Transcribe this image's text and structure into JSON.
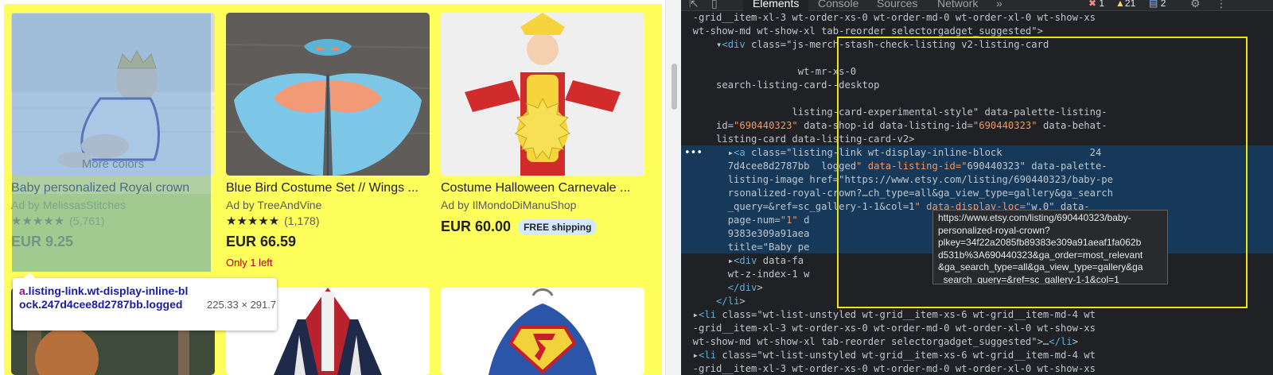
{
  "products": [
    {
      "more_colors": "More colors",
      "title": "Baby personalized Royal crown",
      "ad": "Ad by MelissasStitches",
      "stars": "★★★★★",
      "reviews": "(5,761)",
      "price": "EUR 9.25"
    },
    {
      "title": "Blue Bird Costume Set // Wings ...",
      "ad": "Ad by TreeAndVine",
      "stars": "★★★★★",
      "reviews": "(1,178)",
      "price": "EUR 66.59",
      "stock": "Only 1 left"
    },
    {
      "title": "Costume Halloween Carnevale ...",
      "ad": "Ad by IlMondoDiManuShop",
      "price": "EUR 60.00",
      "shipping": "FREE shipping"
    }
  ],
  "element_tooltip": {
    "tag": "a",
    "selector": ".listing-link.wt-display-inline-block.247d4cee8d2787bb.logged",
    "dims": "225.33 × 291.7"
  },
  "devtools": {
    "tabs": [
      "Elements",
      "Console",
      "Sources",
      "Network"
    ],
    "more": "»",
    "errors": "1",
    "warnings": "21",
    "messages": "2",
    "lines": [
      "  -grid__item-xl-3 wt-order-xs-0 wt-order-md-0 wt-order-xl-0 wt-show-xs",
      "  wt-show-md wt-show-xl tab-reorder selectorgadget_suggested\">",
      "      ▾<div class=\"js-merch-stash-check-listing v2-listing-card",
      "",
      "                    wt-mr-xs-0",
      "      search-listing-card--desktop",
      "",
      "                   listing-card-experimental-style\" data-palette-listing-",
      "      id=\"690440323\" data-shop-id data-listing-id=\"690440323\" data-behat-",
      "      listing-card data-listing-card-v2>",
      "        ▸<a class=\"listing-link wt-display-inline-block               24",
      "        7d4cee8d2787bb  logged\" data-listing-id=\"690440323\" data-palette-",
      "        listing-image href=\"https://www.etsy.com/listing/690440323/baby-pe",
      "        rsonalized-royal-crown?…ch_type=all&ga_view_type=gallery&ga_search",
      "        _query=&ref=sc_gallery-1-1&col=1\" data-display-loc=\"w.0\" data-",
      "        page-num=\"1\" d                                       34f22a2085fb8",
      "        9383e309a91aea                                      0440323\"",
      "        title=\"Baby pe",
      "        ▸<div data-fa                                          card__actions",
      "        wt-z-index-1 w",
      "        </div>",
      "      </li>",
      "  ▸<li class=\"wt-list-unstyled wt-grid__item-xs-6 wt-grid__item-md-4 wt",
      "  -grid__item-xl-3 wt-order-xs-0 wt-order-md-0 wt-order-xl-0 wt-show-xs",
      "  wt-show-md wt-show-xl tab-reorder selectorgadget_suggested\">…</li>",
      "  ▸<li class=\"wt-list-unstyled wt-grid__item-xs-6 wt-grid__item-md-4 wt",
      "  -grid__item-xl-3 wt-order-xs-0 wt-order-md-0 wt-order-xl-0 wt-show-xs"
    ],
    "url_tooltip": "https://www.etsy.com/listing/690440323/baby-\npersonalized-royal-crown?\nplkey=34f22a2085fb89383e309a91aeaf1fa062b\nd531b%3A690440323&ga_order=most_relevant\n&ga_search_type=all&ga_view_type=gallery&ga\n_search_query=&ref=sc_gallery-1-1&col=1"
  }
}
